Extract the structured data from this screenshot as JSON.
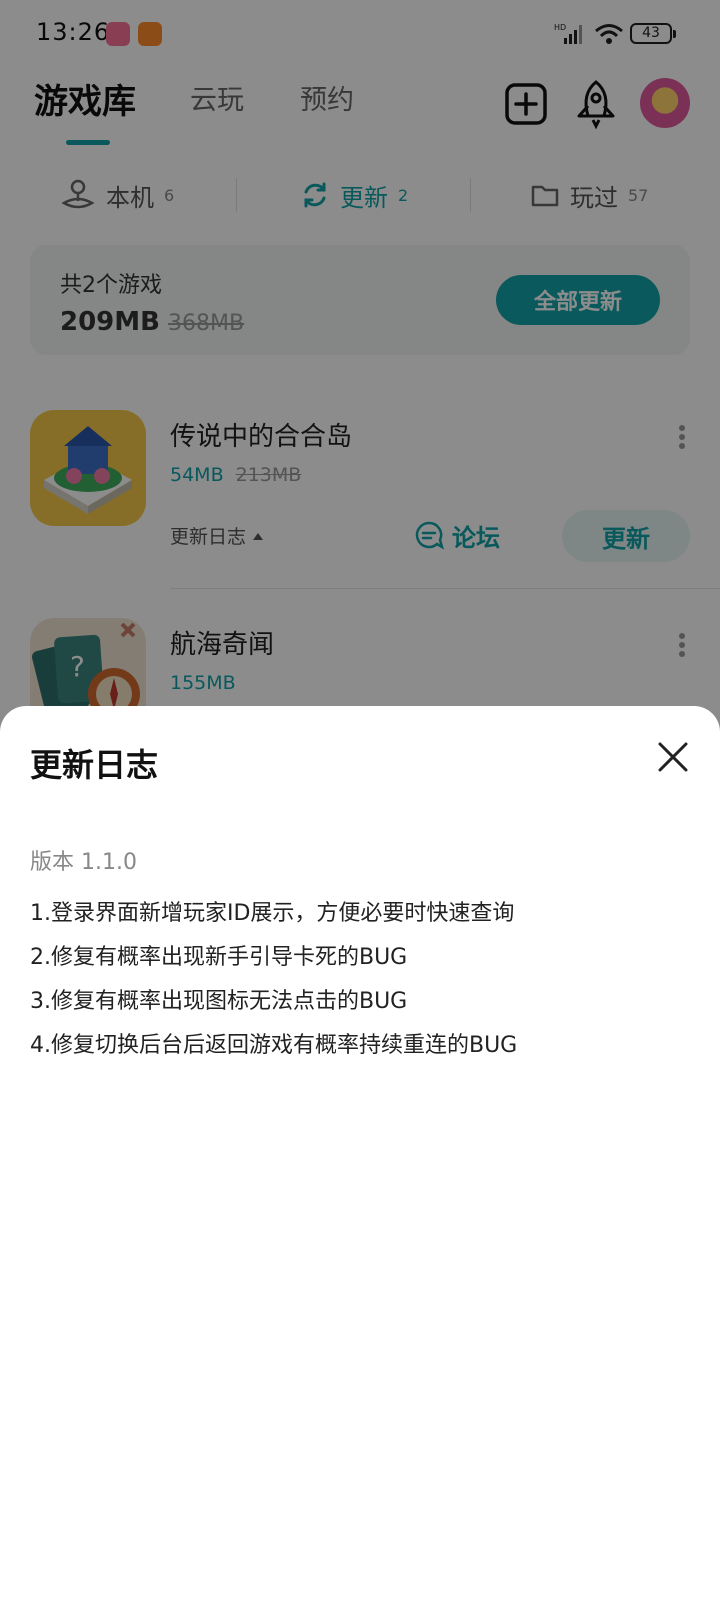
{
  "status_bar": {
    "time": "13:26",
    "battery": "43",
    "network": "HD"
  },
  "top_tabs": [
    {
      "label": "游戏库",
      "active": true
    },
    {
      "label": "云玩",
      "active": false
    },
    {
      "label": "预约",
      "active": false
    }
  ],
  "top_actions": {
    "add_icon": "plus-square-icon",
    "rocket_icon": "rocket-icon",
    "avatar": "user-avatar"
  },
  "sub_tabs": [
    {
      "label": "本机",
      "count": "6",
      "icon": "joystick-icon",
      "active": false
    },
    {
      "label": "更新",
      "count": "2",
      "icon": "refresh-icon",
      "active": true
    },
    {
      "label": "玩过",
      "count": "57",
      "icon": "folder-icon",
      "active": false
    }
  ],
  "summary": {
    "total_text": "共2个游戏",
    "size": "209MB",
    "old_size": "368MB",
    "update_all_label": "全部更新"
  },
  "games": [
    {
      "name": "传说中的合合岛",
      "size": "54MB",
      "old_size": "213MB",
      "log_label": "更新日志",
      "forum_label": "论坛",
      "update_label": "更新"
    },
    {
      "name": "航海奇闻",
      "size": "155MB"
    }
  ],
  "sheet": {
    "title": "更新日志",
    "version": "版本 1.1.0",
    "notes": [
      "1.登录界面新增玩家ID展示，方便必要时快速查询",
      "2.修复有概率出现新手引导卡死的BUG",
      "3.修复有概率出现图标无法点击的BUG",
      "4.修复切换后台后返回游戏有概率持续重连的BUG"
    ]
  },
  "colors": {
    "accent": "#12a3a8",
    "overlay": "rgba(0,0,0,0.45)"
  }
}
